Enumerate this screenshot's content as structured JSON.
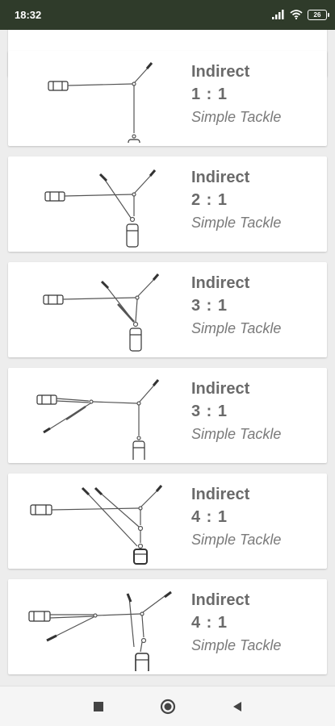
{
  "status_bar": {
    "time": "18:32",
    "battery": "26"
  },
  "cards": [
    {
      "type": "Indirect",
      "ratio": "1 : 1",
      "subtitle": "Simple Tackle"
    },
    {
      "type": "Indirect",
      "ratio": "2 : 1",
      "subtitle": "Simple Tackle"
    },
    {
      "type": "Indirect",
      "ratio": "3 : 1",
      "subtitle": "Simple Tackle"
    },
    {
      "type": "Indirect",
      "ratio": "3 : 1",
      "subtitle": "Simple Tackle"
    },
    {
      "type": "Indirect",
      "ratio": "4 : 1",
      "subtitle": "Simple Tackle"
    },
    {
      "type": "Indirect",
      "ratio": "4 : 1",
      "subtitle": "Simple Tackle"
    }
  ],
  "nav": {
    "icons": [
      "recents-square-icon",
      "home-circle-icon",
      "back-triangle-icon"
    ]
  }
}
